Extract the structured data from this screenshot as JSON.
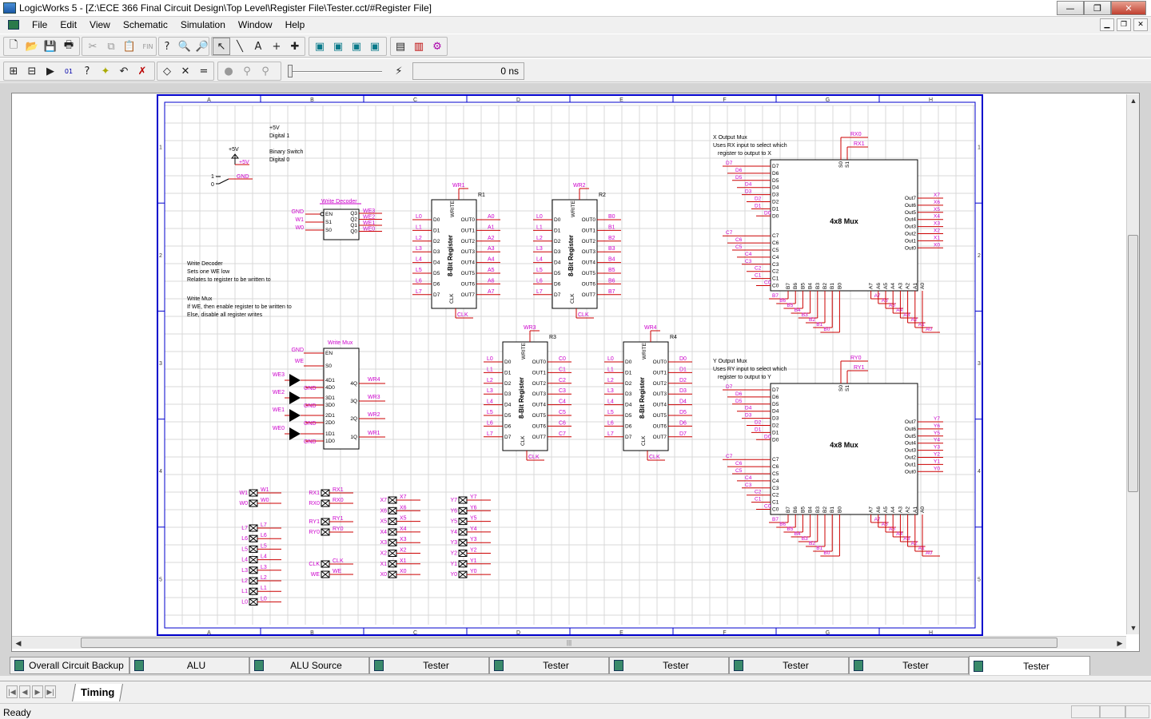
{
  "window": {
    "title": "LogicWorks 5 - [Z:\\ECE 366 Final Circuit Design\\Top Level\\Register File\\Tester.cct/#Register File]",
    "controls": [
      "—",
      "❐",
      "✕"
    ]
  },
  "menu": [
    "File",
    "Edit",
    "View",
    "Schematic",
    "Simulation",
    "Window",
    "Help"
  ],
  "toolbar1": {
    "buttons": [
      "new-icon",
      "open-icon",
      "save-icon",
      "print-icon",
      "cut-icon",
      "copy-icon",
      "paste-icon",
      "final-icon",
      "help-icon",
      "zoom-icon",
      "zoom-fit-icon",
      "pointer-icon",
      "wire-icon",
      "text-icon",
      "cross-icon",
      "plus-icon",
      "library-icon",
      "library2-icon",
      "library3-icon",
      "library4-icon",
      "chip-icon",
      "chart-icon",
      "network-icon"
    ]
  },
  "toolbar2": {
    "buttons": [
      "grid-icon",
      "grid2-icon",
      "run-icon",
      "binary-icon",
      "probe-icon",
      "star-icon",
      "undo-icon",
      "delete-icon",
      "diamond-icon",
      "x-icon",
      "equals-icon",
      "stop-icon",
      "step-icon",
      "step2-icon",
      "pause-icon"
    ],
    "time_value": "0 ns"
  },
  "schematic": {
    "col_labels": [
      "A",
      "B",
      "C",
      "D",
      "E",
      "F",
      "G",
      "H"
    ],
    "row_labels": [
      "1",
      "2",
      "3",
      "4",
      "5"
    ],
    "colors": {
      "border": "#0000cc",
      "grid": "#d8d8d8",
      "wire": "#cc0000",
      "label": "#cc00cc",
      "component": "#000000"
    },
    "notes": {
      "power_line1": "+5V",
      "power_line2": "Digital 1",
      "switch_line1": "Binary Switch",
      "switch_line2": "Digital 0",
      "decoder_note1": "Write Decoder",
      "decoder_note2": "Sets one WE low",
      "decoder_note3": "Relates to register to be written to",
      "mux_note1": "Write Mux",
      "mux_note2": "If WE, then enable register to be written to",
      "mux_note3": "Else, disable all register writes",
      "xmux_note1": "X Output Mux",
      "xmux_note2": "Uses RX input to select which",
      "xmux_note3": "register to output to X",
      "ymux_note1": "Y Output Mux",
      "ymux_note2": "Uses RY input to select which",
      "ymux_note3": "register to output to Y"
    },
    "power": {
      "vcc": "+5V",
      "vcc_label": "+5V",
      "gnd": "GND",
      "one": "1",
      "zero": "0"
    },
    "write_decoder": {
      "title": "Write Decoder",
      "inputs": [
        "EN",
        "S1",
        "S0"
      ],
      "outputs": [
        "Q3",
        "Q2",
        "Q1",
        "Q0"
      ],
      "in_labels": [
        "GND",
        "W1",
        "W0"
      ],
      "out_labels": [
        "WE3",
        "WE2",
        "WE1",
        "WE0"
      ]
    },
    "write_mux": {
      "title": "Write Mux",
      "pins_left": [
        "EN",
        "S0",
        "4D1",
        "4D0",
        "3D1",
        "3D0",
        "2D1",
        "2D0",
        "1D1",
        "1D0"
      ],
      "pins_right": [
        "4Q",
        "3Q",
        "2Q",
        "1Q"
      ],
      "in_labels": [
        "GND",
        "WE"
      ],
      "buf_labels": [
        "WE3",
        "WE2",
        "WE1",
        "WE0"
      ],
      "gnd_label": "GND",
      "out_labels": [
        "WR4",
        "WR3",
        "WR2",
        "WR1"
      ]
    },
    "registers": [
      {
        "ref": "R1",
        "wr": "WR1",
        "in_prefix": "L",
        "out_prefix": "A"
      },
      {
        "ref": "R2",
        "wr": "WR2",
        "in_prefix": "L",
        "out_prefix": "B"
      },
      {
        "ref": "R3",
        "wr": "WR3",
        "in_prefix": "L",
        "out_prefix": "C"
      },
      {
        "ref": "R4",
        "wr": "WR4",
        "in_prefix": "L",
        "out_prefix": "D"
      }
    ],
    "register_type": "8-Bit Register",
    "register_pins": {
      "write": "WRITE",
      "clk": "CLK",
      "clk_label": "CLK",
      "in": [
        "D0",
        "D1",
        "D2",
        "D3",
        "D4",
        "D5",
        "D6",
        "D7"
      ],
      "out": [
        "OUT0",
        "OUT1",
        "OUT2",
        "OUT3",
        "OUT4",
        "OUT5",
        "OUT6",
        "OUT7"
      ]
    },
    "muxes": [
      {
        "name": "4x8 Mux",
        "sel_labels": [
          "RX0",
          "RX1"
        ],
        "out_prefix": "X"
      },
      {
        "name": "4x8 Mux",
        "sel_labels": [
          "RY0",
          "RY1"
        ],
        "out_prefix": "Y"
      }
    ],
    "mux_pins": {
      "sel": [
        "S0",
        "S1"
      ],
      "left": [
        "D7",
        "D6",
        "D5",
        "D4",
        "D3",
        "D2",
        "D1",
        "D0",
        "C7",
        "C6",
        "C5",
        "C4",
        "C3",
        "C2",
        "C1",
        "C0"
      ],
      "bottom": [
        "B7",
        "B6",
        "B5",
        "B4",
        "B3",
        "B2",
        "B1",
        "B0",
        "A7",
        "A6",
        "A5",
        "A4",
        "A3",
        "A2",
        "A1",
        "A0"
      ],
      "right": [
        "Out7",
        "Out6",
        "Out5",
        "Out4",
        "Out3",
        "Out2",
        "Out1",
        "Out0"
      ]
    },
    "io": {
      "w_col": [
        "W1",
        "W0"
      ],
      "l_col": [
        "L7",
        "L6",
        "L5",
        "L4",
        "L3",
        "L2",
        "L1",
        "L0"
      ],
      "rx_col": [
        "RX1",
        "RX0"
      ],
      "ry_col": [
        "RY1",
        "RY0"
      ],
      "clk_col": [
        "CLK",
        "WE"
      ],
      "x_col": [
        "X7",
        "X6",
        "X5",
        "X4",
        "X3",
        "X2",
        "X1",
        "X0"
      ],
      "y_col": [
        "Y7",
        "Y6",
        "Y5",
        "Y4",
        "Y3",
        "Y2",
        "Y1",
        "Y0"
      ]
    }
  },
  "tabs": [
    {
      "label": "Overall Circuit Backup",
      "active": false
    },
    {
      "label": "ALU",
      "active": false
    },
    {
      "label": "ALU Source",
      "active": false
    },
    {
      "label": "Tester",
      "active": false
    },
    {
      "label": "Tester",
      "active": false
    },
    {
      "label": "Tester",
      "active": false
    },
    {
      "label": "Tester",
      "active": false
    },
    {
      "label": "Tester",
      "active": false
    },
    {
      "label": "Tester",
      "active": true
    }
  ],
  "timing_tab": "Timing",
  "status": {
    "text": "Ready"
  }
}
